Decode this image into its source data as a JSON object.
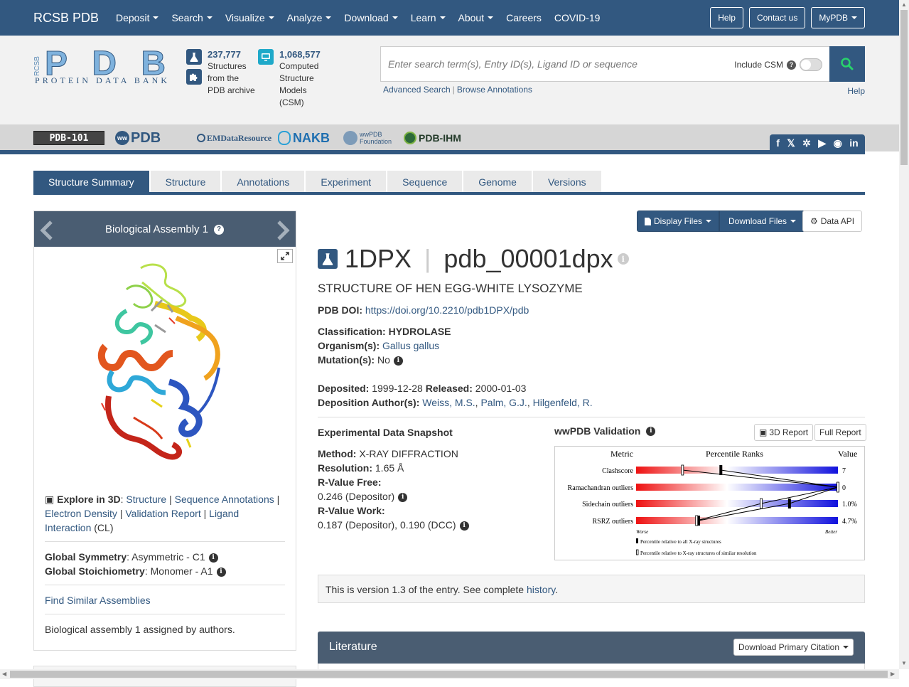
{
  "nav": {
    "brand": "RCSB PDB",
    "menu": [
      "Deposit",
      "Search",
      "Visualize",
      "Analyze",
      "Download",
      "Learn",
      "About",
      "Careers",
      "COVID-19"
    ],
    "menu_dropdown": [
      true,
      true,
      true,
      true,
      true,
      true,
      true,
      false,
      false
    ],
    "help": "Help",
    "contact": "Contact us",
    "mypdb": "MyPDB"
  },
  "header": {
    "logo_rcsb": "RCSB",
    "logo_pdb": "PDB",
    "logo_sub": "PROTEIN DATA BANK",
    "stat1": {
      "num": "237,777",
      "l1": "Structures",
      "l2": "from the",
      "l3": "PDB archive"
    },
    "stat2": {
      "num": "1,068,577",
      "l1": "Computed",
      "l2": "Structure",
      "l3": "Models",
      "l4": "(CSM)"
    },
    "search_placeholder": "Enter search term(s), Entry ID(s), Ligand ID or sequence",
    "include_csm": "Include CSM",
    "advanced": "Advanced Search",
    "browse": "Browse Annotations",
    "help": "Help"
  },
  "partners": {
    "pdb101": "PDB-101",
    "wwpdb": "PDB",
    "emdr": "EMDataResource",
    "nakb": "NAKB",
    "foundation": "wwPDB Foundation",
    "ihm": "PDB-IHM",
    "social": [
      "f",
      "X",
      "bsky",
      "yt",
      "gh",
      "in"
    ]
  },
  "tabs": [
    "Structure Summary",
    "Structure",
    "Annotations",
    "Experiment",
    "Sequence",
    "Genome",
    "Versions"
  ],
  "left": {
    "assembly": "Biological Assembly 1",
    "explore_label": "Explore in 3D",
    "explore_links": [
      "Structure",
      "Sequence Annotations",
      "Electron Density",
      "Validation Report",
      "Ligand Interaction"
    ],
    "ligand_suffix": "(CL)",
    "symmetry_label": "Global Symmetry",
    "symmetry_value": ": Asymmetric - C1",
    "stoich_label": "Global Stoichiometry",
    "stoich_value": ": Monomer - A1",
    "similar": "Find Similar Assemblies",
    "assigned": "Biological assembly 1 assigned by authors."
  },
  "entry": {
    "display_files": "Display Files",
    "download_files": "Download Files",
    "data_api": "Data API",
    "id": "1DPX",
    "ext_id": "pdb_00001dpx",
    "title": "STRUCTURE OF HEN EGG-WHITE LYSOZYME",
    "doi_label": "PDB DOI:",
    "doi": "https://doi.org/10.2210/pdb1DPX/pdb",
    "class_label": "Classification:",
    "classification": "HYDROLASE",
    "org_label": "Organism(s):",
    "organism": "Gallus gallus",
    "mut_label": "Mutation(s):",
    "mutation": "No",
    "dep_label": "Deposited:",
    "deposited": "1999-12-28",
    "rel_label": "Released:",
    "released": "2000-01-03",
    "auth_label": "Deposition Author(s):",
    "authors": [
      "Weiss, M.S.",
      "Palm, G.J.",
      "Hilgenfeld, R."
    ]
  },
  "snapshot": {
    "heading": "Experimental Data Snapshot",
    "method_label": "Method:",
    "method": "X-RAY DIFFRACTION",
    "res_label": "Resolution:",
    "resolution": "1.65 Å",
    "rfree_label": "R-Value Free:",
    "rfree": "0.246 (Depositor)",
    "rwork_label": "R-Value Work:",
    "rwork": "0.187 (Depositor), 0.190 (DCC)"
  },
  "validation": {
    "heading": "wwPDB Validation",
    "report3d": "3D Report",
    "full": "Full Report",
    "col_metric": "Metric",
    "col_pct": "Percentile Ranks",
    "col_value": "Value",
    "worse": "Worse",
    "better": "Better",
    "legend1": "Percentile relative to all X-ray structures",
    "legend2": "Percentile relative to X-ray structures of similar resolution",
    "rows": [
      {
        "metric": "Clashscore",
        "value": "7",
        "all_pct": 0.42,
        "similar_pct": 0.23
      },
      {
        "metric": "Ramachandran outliers",
        "value": "0",
        "all_pct": 1.0,
        "similar_pct": 1.0
      },
      {
        "metric": "Sidechain outliers",
        "value": "1.0%",
        "all_pct": 0.76,
        "similar_pct": 0.62
      },
      {
        "metric": "RSRZ outliers",
        "value": "4.7%",
        "all_pct": 0.31,
        "similar_pct": 0.3
      }
    ]
  },
  "version": {
    "text": "This is version 1.3 of the entry. See complete ",
    "link": "history",
    "end": "."
  },
  "literature": {
    "heading": "Literature",
    "button": "Download Primary Citation"
  }
}
